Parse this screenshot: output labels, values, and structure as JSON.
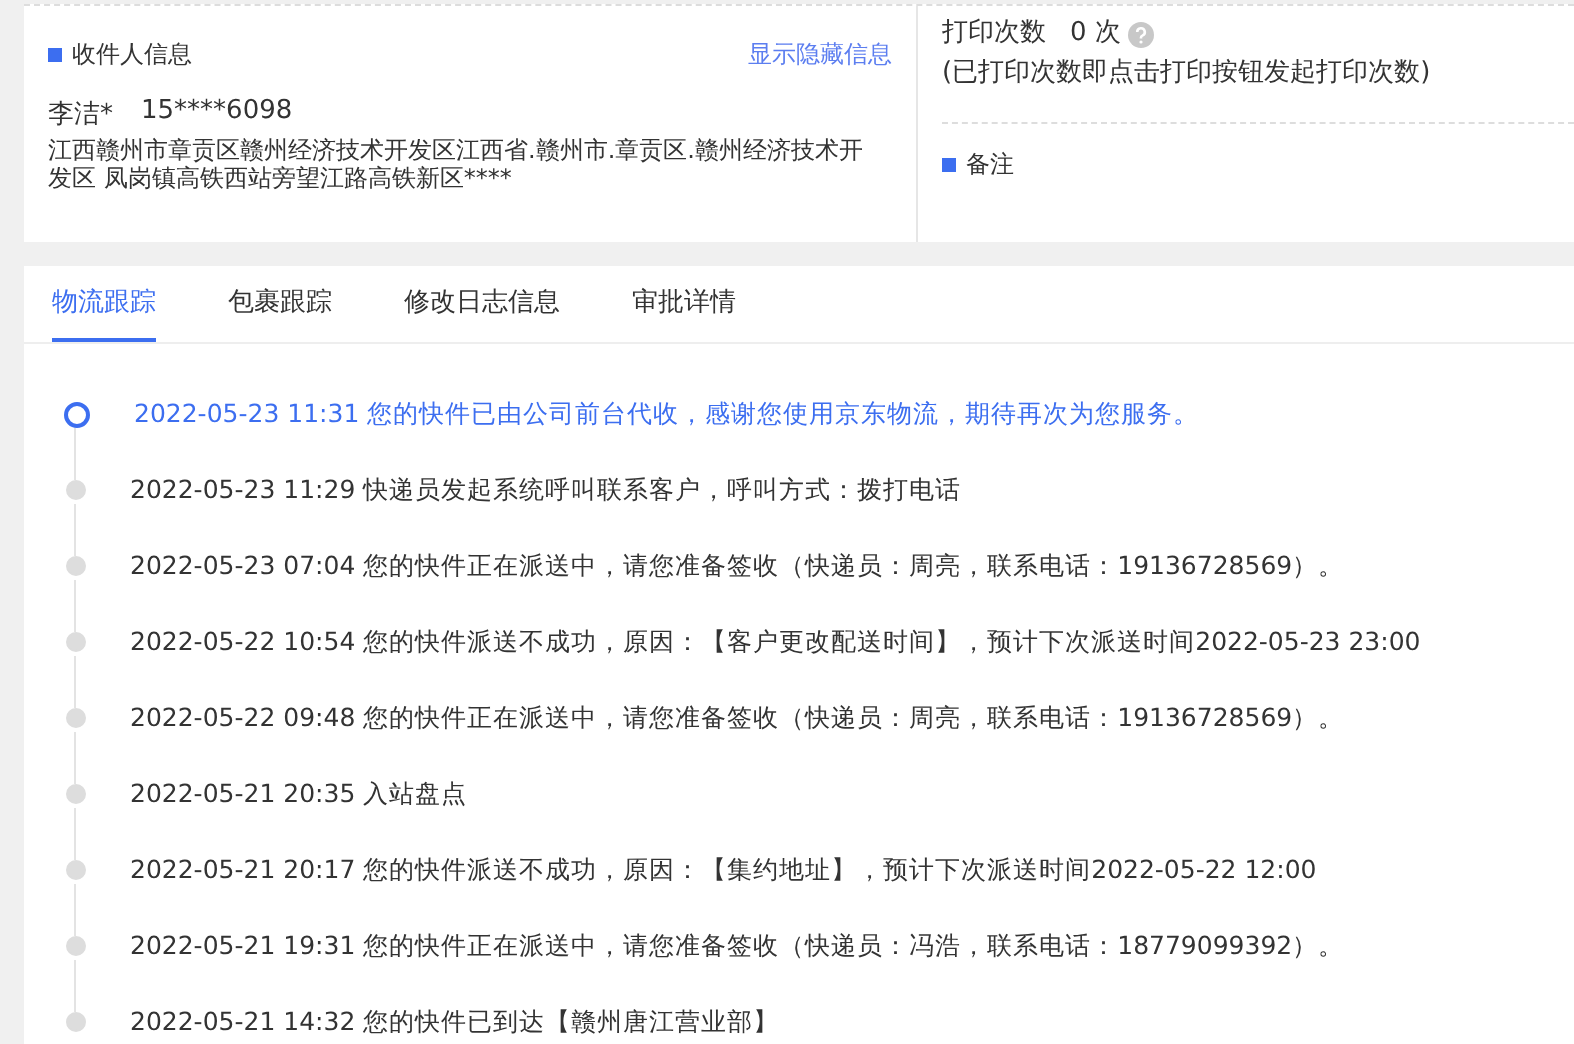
{
  "recipient": {
    "title": "收件人信息",
    "toggle_link": "显示隐藏信息",
    "name": "李洁*",
    "phone": "15****6098",
    "address": "江西赣州市章贡区赣州经济技术开发区江西省.赣州市.章贡区.赣州经济技术开发区 凤岗镇高铁西站旁望江路高铁新区****"
  },
  "print": {
    "label": "打印次数",
    "count": "0 次",
    "note": "(已打印次数即点击打印按钮发起打印次数)"
  },
  "remarks": {
    "title": "备注"
  },
  "tabs": [
    {
      "label": "物流跟踪",
      "selected": true
    },
    {
      "label": "包裹跟踪",
      "selected": false
    },
    {
      "label": "修改日志信息",
      "selected": false
    },
    {
      "label": "审批详情",
      "selected": false
    }
  ],
  "timeline": [
    {
      "time": "2022-05-23 11:31",
      "text": "您的快件已由公司前台代收，感谢您使用京东物流，期待再次为您服务。",
      "current": true
    },
    {
      "time": "2022-05-23 11:29",
      "text": "快递员发起系统呼叫联系客户，呼叫方式：拨打电话",
      "current": false
    },
    {
      "time": "2022-05-23 07:04",
      "text": "您的快件正在派送中，请您准备签收（快递员：周亮，联系电话：19136728569）。",
      "current": false
    },
    {
      "time": "2022-05-22 10:54",
      "text": "您的快件派送不成功，原因：【客户更改配送时间】，预计下次派送时间2022-05-23 23:00",
      "current": false
    },
    {
      "time": "2022-05-22 09:48",
      "text": "您的快件正在派送中，请您准备签收（快递员：周亮，联系电话：19136728569）。",
      "current": false
    },
    {
      "time": "2022-05-21 20:35",
      "text": "入站盘点",
      "current": false
    },
    {
      "time": "2022-05-21 20:17",
      "text": "您的快件派送不成功，原因：【集约地址】，预计下次派送时间2022-05-22 12:00",
      "current": false
    },
    {
      "time": "2022-05-21 19:31",
      "text": "您的快件正在派送中，请您准备签收（快递员：冯浩，联系电话：18779099392）。",
      "current": false
    },
    {
      "time": "2022-05-21 14:32",
      "text": "您的快件已到达【赣州唐江营业部】",
      "current": false
    }
  ]
}
